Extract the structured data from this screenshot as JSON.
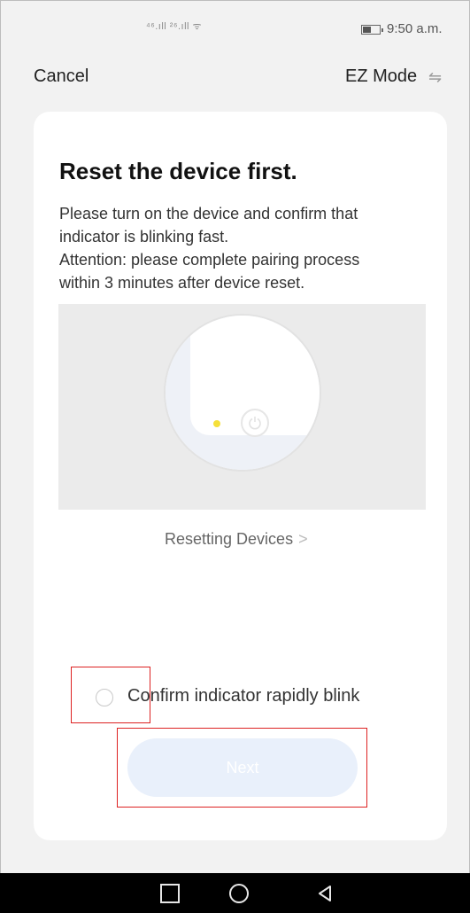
{
  "status_bar": {
    "signal_text": "⁴⁶.ıll ²⁶.ıll ᯤ",
    "time": "9:50 a.m."
  },
  "nav": {
    "cancel_label": "Cancel",
    "mode_label": "EZ Mode",
    "mode_icon": "swap-icon"
  },
  "card": {
    "title": "Reset the device first.",
    "desc_line1": "Please turn on the device and confirm that",
    "desc_line2": "indicator is blinking fast.",
    "desc_line3": "Attention: please complete pairing process",
    "desc_line4": "within 3 minutes after device reset.",
    "resetting_link": "Resetting Devices",
    "confirm_label": "Confirm indicator rapidly blink",
    "next_label": "Next"
  },
  "colors": {
    "led": "#f5e03a",
    "next_bg": "#e9f0fb",
    "highlight": "#dd2222"
  }
}
